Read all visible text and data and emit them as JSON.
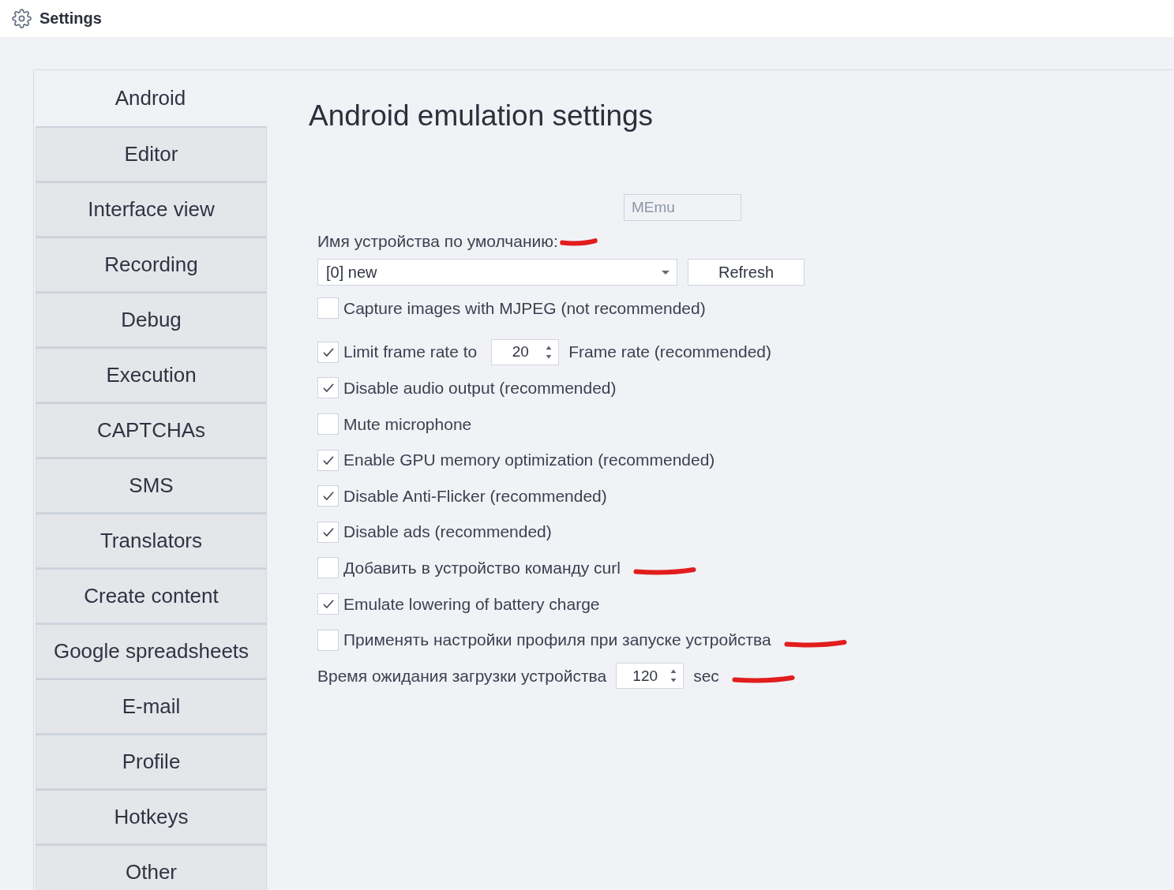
{
  "window": {
    "title": "Settings"
  },
  "sidebar": {
    "tabs": [
      {
        "label": "Android",
        "selected": true
      },
      {
        "label": "Editor",
        "selected": false
      },
      {
        "label": "Interface view",
        "selected": false
      },
      {
        "label": "Recording",
        "selected": false
      },
      {
        "label": "Debug",
        "selected": false
      },
      {
        "label": "Execution",
        "selected": false
      },
      {
        "label": "CAPTCHAs",
        "selected": false
      },
      {
        "label": "SMS",
        "selected": false
      },
      {
        "label": "Translators",
        "selected": false
      },
      {
        "label": "Create content",
        "selected": false
      },
      {
        "label": "Google spreadsheets",
        "selected": false
      },
      {
        "label": "E-mail",
        "selected": false
      },
      {
        "label": "Profile",
        "selected": false
      },
      {
        "label": "Hotkeys",
        "selected": false
      },
      {
        "label": "Other",
        "selected": false
      }
    ]
  },
  "content": {
    "heading": "Android emulation settings",
    "emulator_field": {
      "value": "MEmu",
      "disabled": true
    },
    "device_label": {
      "text": "Имя устройства по умолчанию:",
      "marked": true
    },
    "device_dropdown": {
      "value": "[0] new"
    },
    "refresh_button": {
      "label": "Refresh"
    },
    "options": [
      {
        "kind": "check",
        "label": "Capture images with MJPEG (not recommended)",
        "checked": false,
        "marked": false
      },
      {
        "kind": "check_spin",
        "label": "Limit frame rate to",
        "checked": true,
        "value": "20",
        "suffix": "Frame rate (recommended)",
        "marked": false
      },
      {
        "kind": "check",
        "label": "Disable audio output (recommended)",
        "checked": true,
        "marked": false
      },
      {
        "kind": "check",
        "label": "Mute microphone",
        "checked": false,
        "marked": false
      },
      {
        "kind": "check",
        "label": "Enable GPU memory optimization (recommended)",
        "checked": true,
        "marked": false
      },
      {
        "kind": "check",
        "label": "Disable Anti-Flicker (recommended)",
        "checked": true,
        "marked": false
      },
      {
        "kind": "check",
        "label": "Disable ads (recommended)",
        "checked": true,
        "marked": false
      },
      {
        "kind": "check",
        "label": "Добавить в устройство команду curl",
        "checked": false,
        "marked": true
      },
      {
        "kind": "check",
        "label": "Emulate lowering of battery charge",
        "checked": true,
        "marked": false
      },
      {
        "kind": "check",
        "label": "Применять настройки профиля при запуске устройства",
        "checked": false,
        "marked": true
      },
      {
        "kind": "spin",
        "label": "Время ожидания загрузки устройства",
        "value": "120",
        "suffix": "sec",
        "marked": true
      }
    ]
  }
}
